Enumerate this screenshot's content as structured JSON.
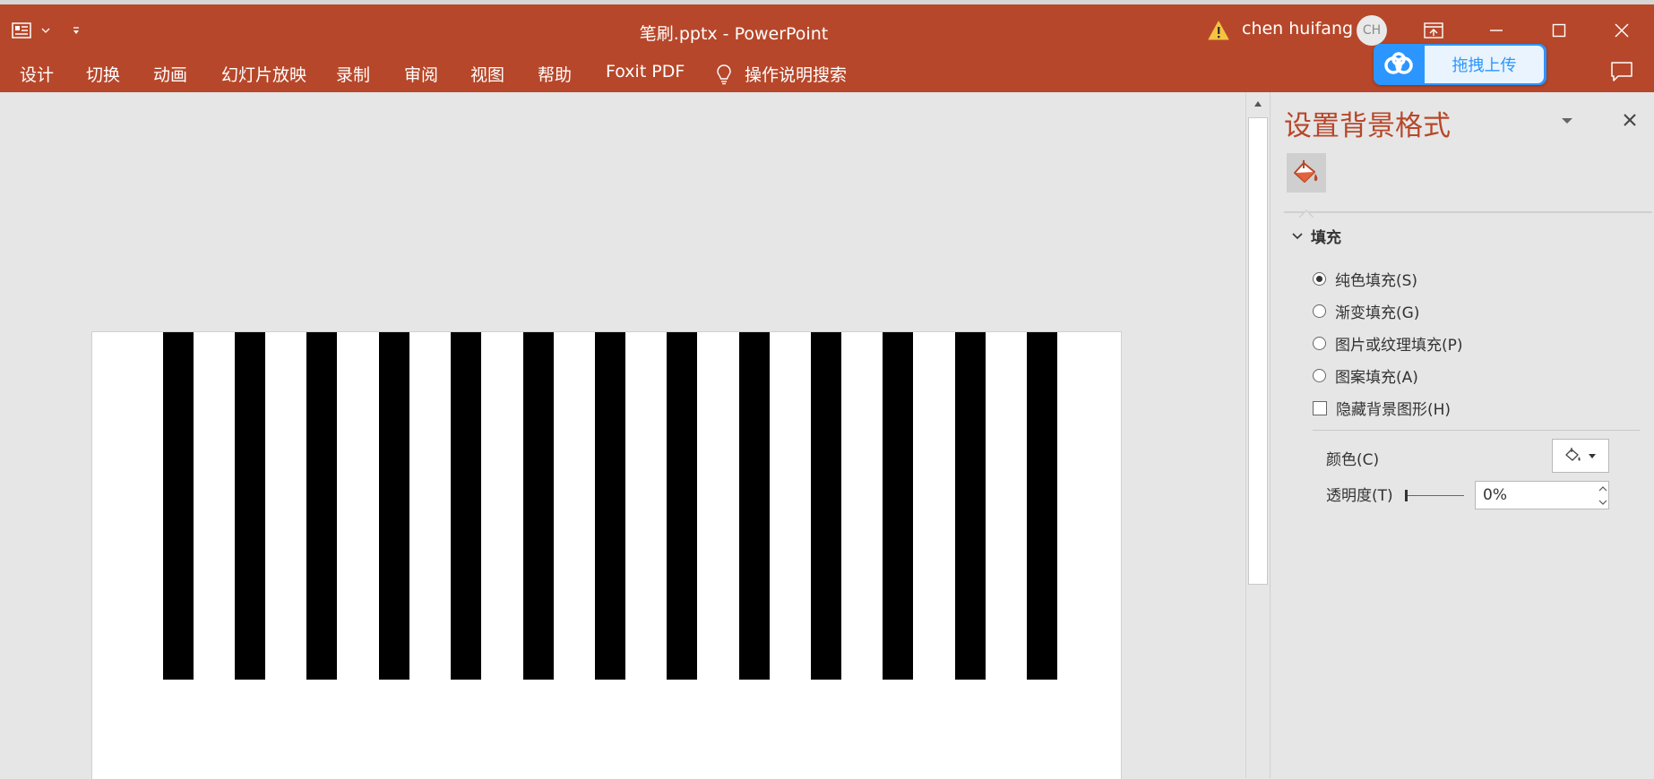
{
  "window": {
    "title": "笔刷.pptx  -  PowerPoint",
    "user_name": "chen huifang",
    "avatar_initials": "CH",
    "accent_color": "#b7472a"
  },
  "qat_icons": [
    "slide-layout-icon",
    "dropdown-chevron-icon",
    "customize-toolbar-icon"
  ],
  "menu": {
    "items": [
      "设计",
      "切换",
      "动画",
      "幻灯片放映",
      "录制",
      "审阅",
      "视图",
      "帮助",
      "Foxit PDF"
    ],
    "search_label": "操作说明搜索"
  },
  "upload_widget": {
    "label": "拖拽上传",
    "color": "#2b96ff"
  },
  "pane": {
    "title": "设置背景格式",
    "section_label": "填充",
    "options": [
      {
        "label": "纯色填充(S)",
        "selected": true
      },
      {
        "label": "渐变填充(G)",
        "selected": false
      },
      {
        "label": "图片或纹理填充(P)",
        "selected": false
      },
      {
        "label": "图案填充(A)",
        "selected": false
      }
    ],
    "hide_background_label": "隐藏背景图形(H)",
    "color_label": "颜色(C)",
    "transparency_label": "透明度(T)",
    "transparency_value": "0%"
  }
}
